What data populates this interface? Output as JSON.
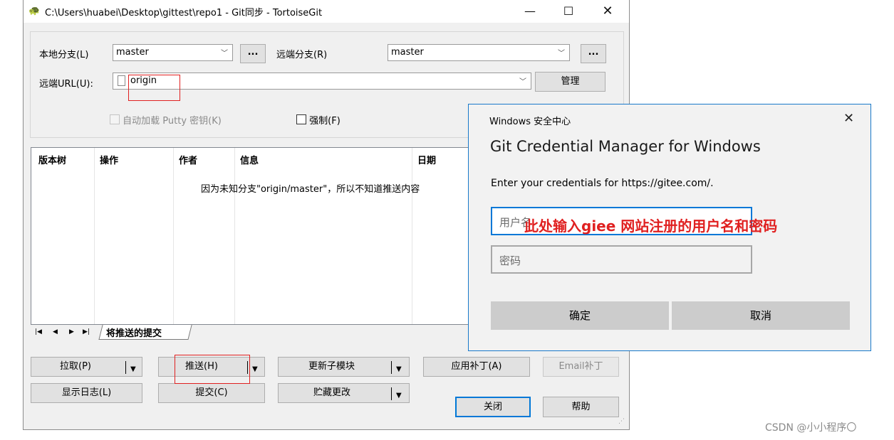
{
  "window": {
    "title": "C:\\Users\\huabei\\Desktop\\gittest\\repo1 - Git同步 - TortoiseGit",
    "minimize": "—",
    "maximize": "☐",
    "close": "✕"
  },
  "branch": {
    "local_label": "本地分支(L)",
    "local_value": "master",
    "remote_label": "远端分支(R)",
    "remote_value": "master",
    "browse": "..."
  },
  "url": {
    "label": "远端URL(U):",
    "value": "origin",
    "manage": "管理"
  },
  "options": {
    "autoload_putty": "自动加载 Putty 密钥(K)",
    "force": "强制(F)"
  },
  "log": {
    "columns": [
      "版本树",
      "操作",
      "作者",
      "信息",
      "日期"
    ],
    "message": "因为未知分支\"origin/master\"，所以不知道推送内容",
    "tab": "将推送的提交"
  },
  "buttons": {
    "pull": "拉取(P)",
    "push": "推送(H)",
    "update_submodule": "更新子模块",
    "apply_patch": "应用补丁(A)",
    "email_patch": "Email补丁",
    "show_log": "显示日志(L)",
    "commit": "提交(C)",
    "stash": "贮藏更改",
    "close": "关闭",
    "help": "帮助"
  },
  "credential": {
    "window_title": "Windows 安全中心",
    "close": "✕",
    "heading": "Git Credential Manager for Windows",
    "prompt": "Enter your credentials for https://gitee.com/.",
    "username_placeholder": "用户名",
    "password_placeholder": "密码",
    "ok": "确定",
    "cancel": "取消"
  },
  "annotation": {
    "text": "此处输入giee 网站注册的用户名和密码",
    "color": "#e02020"
  },
  "watermark": "CSDN @小小程序〇"
}
